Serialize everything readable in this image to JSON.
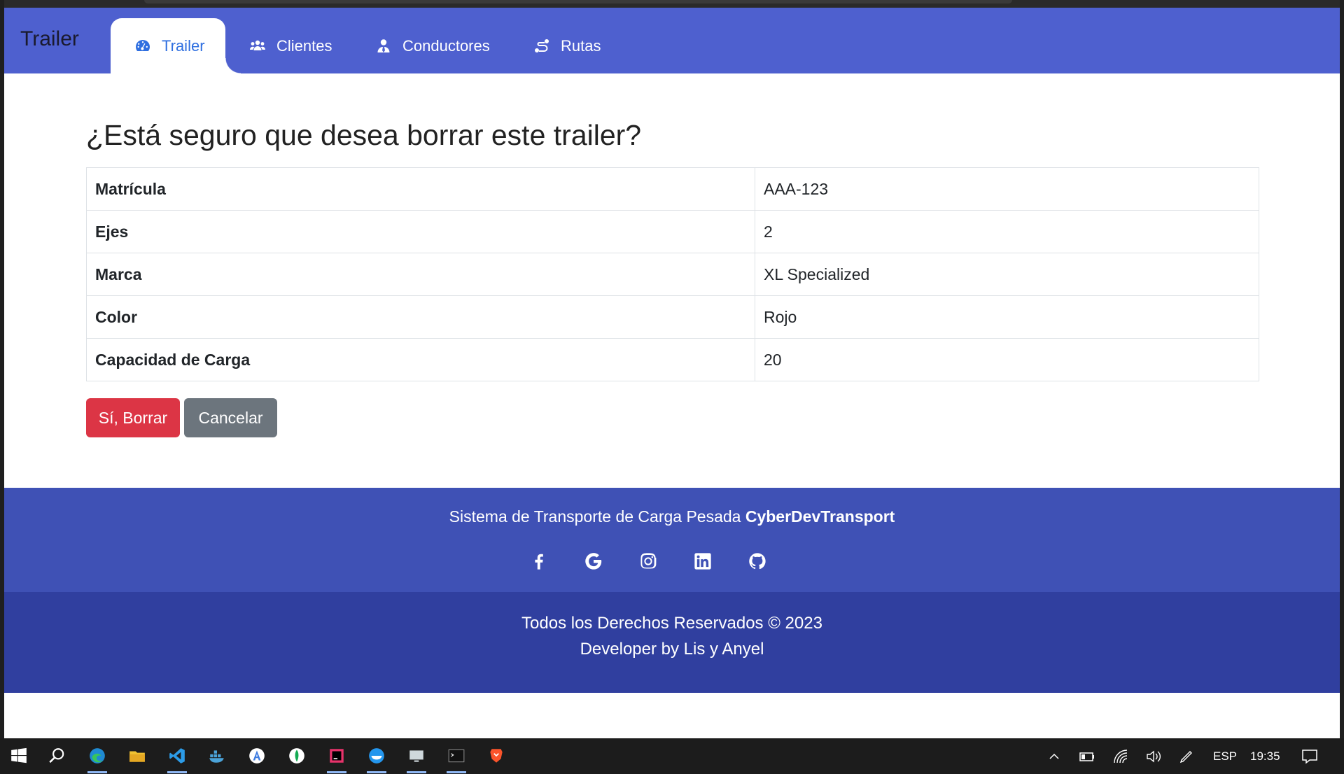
{
  "navbar": {
    "brand": "Trailer",
    "tabs": [
      {
        "label": "Trailer",
        "icon": "gauge-icon",
        "active": true
      },
      {
        "label": "Clientes",
        "icon": "users-icon"
      },
      {
        "label": "Conductores",
        "icon": "user-tie-icon"
      },
      {
        "label": "Rutas",
        "icon": "route-icon"
      }
    ]
  },
  "main": {
    "heading": "¿Está seguro que desea borrar este trailer?",
    "rows": [
      {
        "key": "Matrícula",
        "value": "AAA-123"
      },
      {
        "key": "Ejes",
        "value": "2"
      },
      {
        "key": "Marca",
        "value": "XL Specialized"
      },
      {
        "key": "Color",
        "value": "Rojo"
      },
      {
        "key": "Capacidad de Carga",
        "value": "20"
      }
    ],
    "confirm_label": "Sí, Borrar",
    "cancel_label": "Cancelar"
  },
  "footer": {
    "tagline": "Sistema de Transporte de Carga Pesada ",
    "brand": "CyberDevTransport",
    "social": [
      "facebook-icon",
      "google-icon",
      "instagram-icon",
      "linkedin-icon",
      "github-icon"
    ],
    "copyright": "Todos los Derechos Reservados © 2023",
    "credits": "Developer by Lis y Anyel"
  },
  "taskbar": {
    "language": "ESP",
    "time": "19:35"
  },
  "colors": {
    "nav_bg": "#4e60cf",
    "footer_top": "#3f51b5",
    "footer_bottom": "#303f9f",
    "danger": "#dc3545",
    "secondary": "#6c757d",
    "active_tab_text": "#2f6fe0"
  }
}
